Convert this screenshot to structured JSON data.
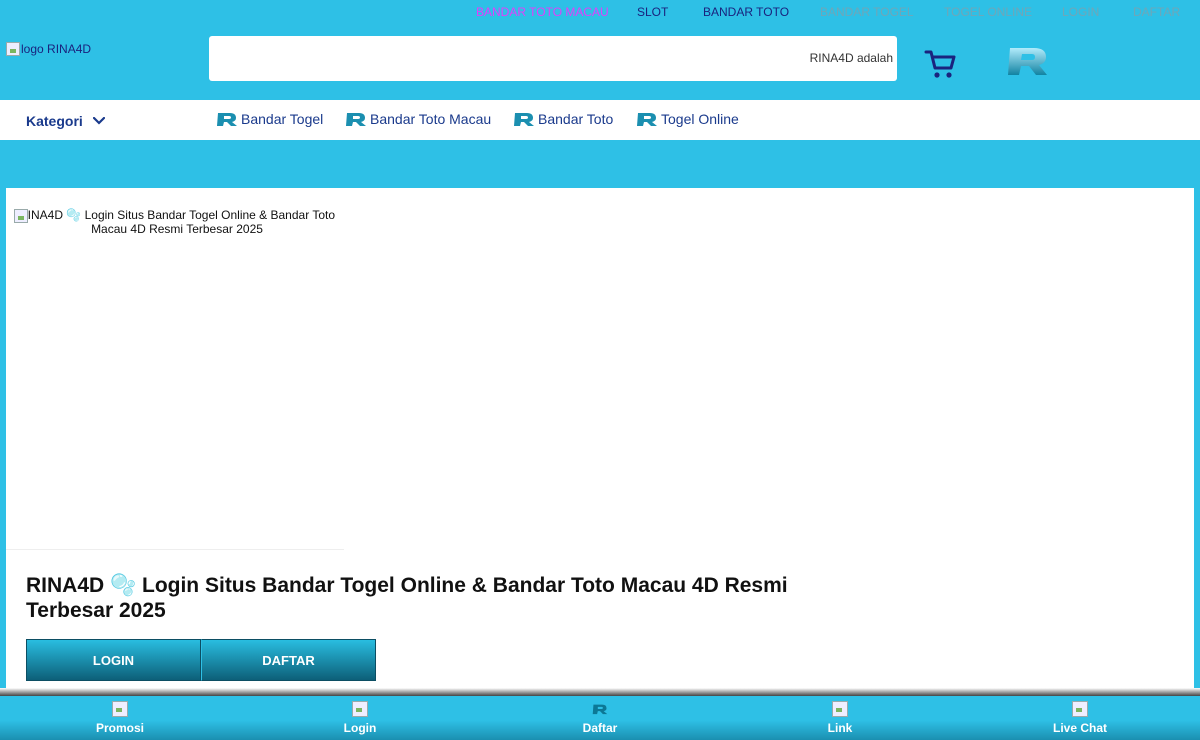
{
  "topbar": {
    "links": [
      {
        "label": "BANDAR TOTO MACAU",
        "color": "#e040fb"
      },
      {
        "label": "SLOT",
        "color": "#1a237e"
      },
      {
        "label": "BANDAR TOTO",
        "color": "#1a237e"
      },
      {
        "label": "BANDAR TOGEL",
        "color": "#6fa6b8"
      },
      {
        "label": "TOGEL ONLINE",
        "color": "#6fa6b8"
      },
      {
        "label": "LOGIN",
        "color": "#6fa6b8"
      },
      {
        "label": "DAFTAR",
        "color": "#6fa6b8"
      }
    ]
  },
  "header": {
    "logo_alt": "logo RINA4D",
    "marquee_text": "RINA4D adalah",
    "cart_icon": "cart-icon",
    "brand_icon": "r-brand-icon"
  },
  "catnav": {
    "kategori_label": "Kategori",
    "links": [
      {
        "label": "Bandar Togel"
      },
      {
        "label": "Bandar Toto Macau"
      },
      {
        "label": "Bandar Toto"
      },
      {
        "label": "Togel Online"
      }
    ]
  },
  "content": {
    "image_alt": "RINA4D 🫧 Login Situs Bandar Togel Online & Bandar Toto Macau 4D Resmi Terbesar 2025",
    "title": "RINA4D 🫧 Login Situs Bandar Togel Online & Bandar Toto Macau 4D Resmi Terbesar 2025",
    "login_label": "LOGIN",
    "daftar_label": "DAFTAR"
  },
  "bottomnav": {
    "items": [
      {
        "label": "Promosi",
        "icon": "promo-icon"
      },
      {
        "label": "Login",
        "icon": "login-icon"
      },
      {
        "label": "Daftar",
        "icon": "r-brand-icon"
      },
      {
        "label": "Link",
        "icon": "link-icon"
      },
      {
        "label": "Live Chat",
        "icon": "chat-icon"
      }
    ]
  },
  "colors": {
    "brand_blue": "#2ec0e6",
    "nav_text": "#1a3a8c",
    "button_dark": "#0d5f78"
  }
}
